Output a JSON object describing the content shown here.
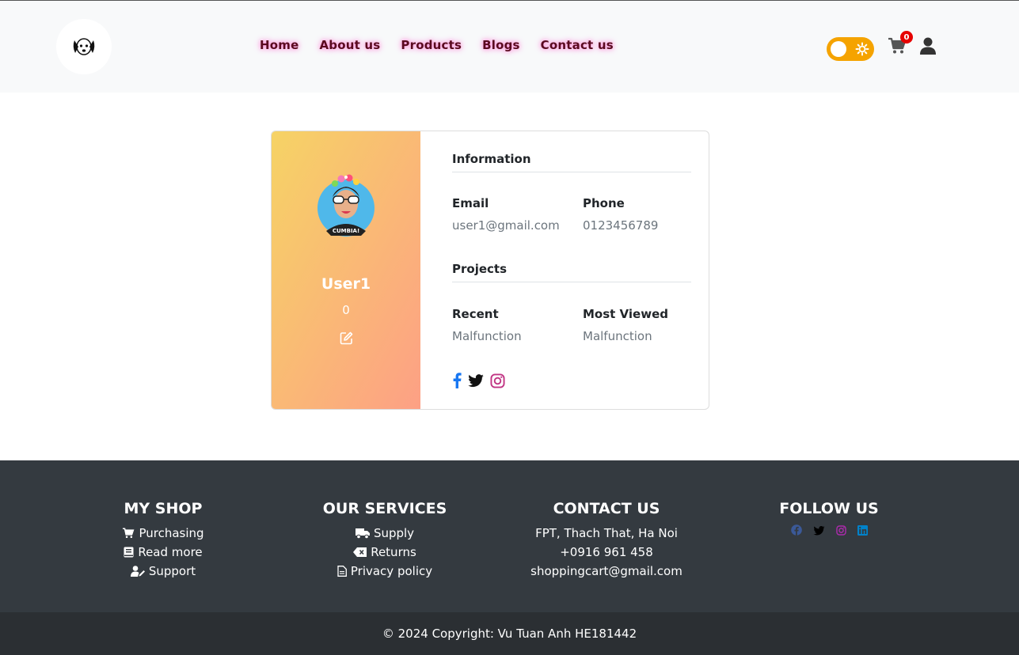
{
  "nav": {
    "items": [
      {
        "label": "Home"
      },
      {
        "label": "About us"
      },
      {
        "label": "Products"
      },
      {
        "label": "Blogs"
      },
      {
        "label": "Contact us"
      }
    ],
    "cart_count": "0"
  },
  "profile": {
    "name": "User1",
    "count": "0",
    "information_title": "Information",
    "email_label": "Email",
    "email_value": "user1@gmail.com",
    "phone_label": "Phone",
    "phone_value": "0123456789",
    "projects_title": "Projects",
    "recent_label": "Recent",
    "recent_value": "Malfunction",
    "most_viewed_label": "Most Viewed",
    "most_viewed_value": "Malfunction",
    "avatar_text": "CUMBIA!"
  },
  "footer": {
    "shop": {
      "title": "MY SHOP",
      "items": [
        "Purchasing",
        "Read more",
        "Support"
      ]
    },
    "services": {
      "title": "OUR SERVICES",
      "items": [
        "Supply",
        "Returns",
        "Privacy policy"
      ]
    },
    "contact": {
      "title": "CONTACT US",
      "items": [
        "FPT, Thach That, Ha Noi",
        "+0916 961 458",
        "shoppingcart@gmail.com"
      ]
    },
    "follow": {
      "title": "FOLLOW US"
    },
    "copyright": "© 2024 Copyright: Vu Tuan Anh HE181442"
  },
  "colors": {
    "accent_toggle": "#f5a300",
    "footer_bg": "#343a40",
    "gradient_start": "#f6d365",
    "gradient_end": "#fda085"
  }
}
